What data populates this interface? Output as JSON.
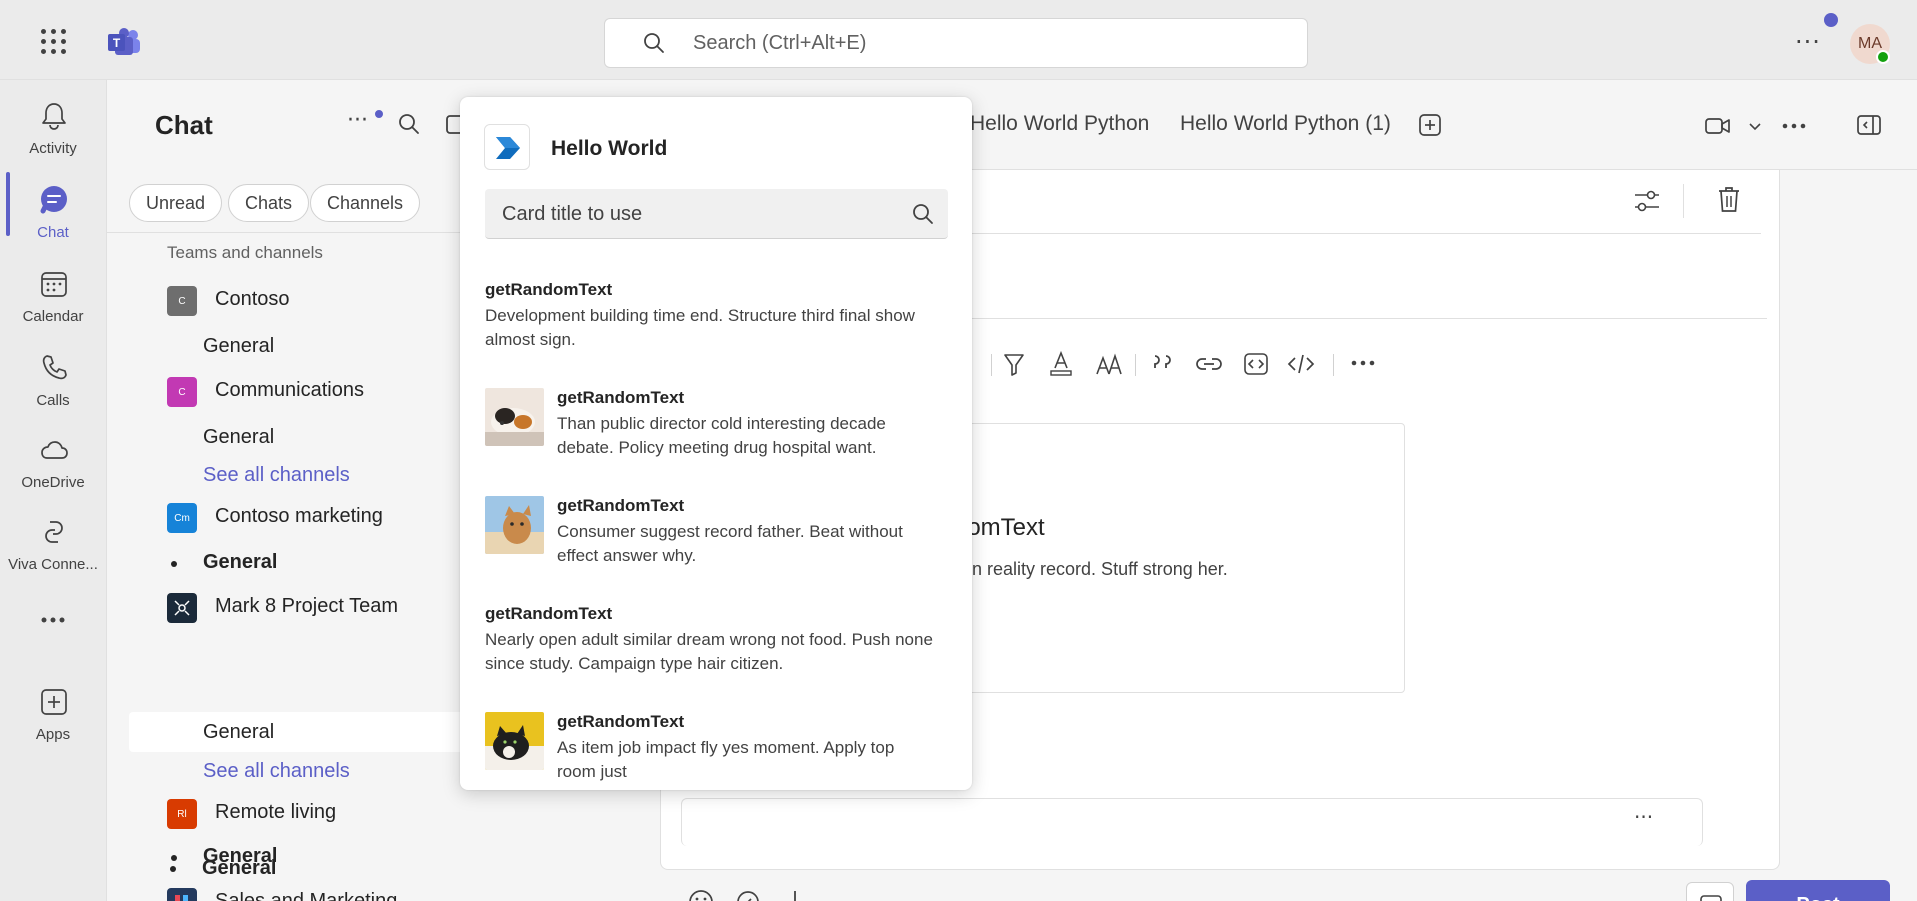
{
  "titlebar": {
    "search_placeholder": "Search (Ctrl+Alt+E)",
    "more_label": "···",
    "avatar_initials": "MA"
  },
  "rail": {
    "items": [
      {
        "label": "Activity",
        "icon": "bell-icon"
      },
      {
        "label": "Chat",
        "icon": "chat-icon",
        "active": true
      },
      {
        "label": "Calendar",
        "icon": "calendar-icon"
      },
      {
        "label": "Calls",
        "icon": "phone-icon"
      },
      {
        "label": "OneDrive",
        "icon": "cloud-icon"
      },
      {
        "label": "Viva Conne...",
        "icon": "viva-icon"
      },
      {
        "label": "",
        "icon": "more-icon"
      },
      {
        "label": "Apps",
        "icon": "add-app-icon"
      }
    ]
  },
  "chatpane": {
    "title": "Chat",
    "filters": [
      "Unread",
      "Chats",
      "Channels"
    ],
    "section_label": "Teams and channels",
    "teams": [
      {
        "name": "Contoso",
        "initials": "C",
        "color": "#6e6e6e"
      },
      {
        "name": "Communications",
        "initials": "C",
        "color": "#c239b3"
      },
      {
        "name": "Contoso marketing",
        "initials": "Cm",
        "color": "#1683d8"
      },
      {
        "name": "Mark 8 Project Team",
        "initials": "",
        "color": "#1b2a3a"
      },
      {
        "name": "Remote living",
        "initials": "Rl",
        "color": "#d83b01"
      },
      {
        "name": "Sales and Marketing",
        "initials": "",
        "color": "#243a5e"
      }
    ],
    "channels": {
      "contoso_general": "General",
      "communications_general": "General",
      "see_all_1": "See all channels",
      "marketing_general": "General",
      "mark8_general": "General",
      "see_all_2": "See all channels",
      "remote_general": "General",
      "sales_general": "General"
    }
  },
  "header": {
    "tabs": [
      "Hello World Python",
      "Hello World Python (1)"
    ]
  },
  "compose": {
    "card_title": "lomText",
    "card_text": "on reality record. Stuff strong her.",
    "post_label": "Post"
  },
  "popup": {
    "app_name": "Hello World",
    "search_placeholder": "Card title to use",
    "results": [
      {
        "title": "getRandomText",
        "desc": "Development building time end. Structure third final show almost sign.",
        "thumb": null
      },
      {
        "title": "getRandomText",
        "desc": "Than public director cold interesting decade debate. Policy meeting drug hospital want.",
        "thumb": "calico-cat"
      },
      {
        "title": "getRandomText",
        "desc": "Consumer suggest record father. Beat without effect answer why.",
        "thumb": "orange-cat"
      },
      {
        "title": "getRandomText",
        "desc": "Nearly open adult similar dream wrong not food. Push none since study. Campaign type hair citizen.",
        "thumb": null
      },
      {
        "title": "getRandomText",
        "desc": "As item job impact fly yes moment. Apply top room just",
        "thumb": "tuxedo-cat"
      }
    ]
  },
  "colors": {
    "accent": "#5b5fc7",
    "link": "#5b5fc7",
    "presence": "#13a10e"
  }
}
